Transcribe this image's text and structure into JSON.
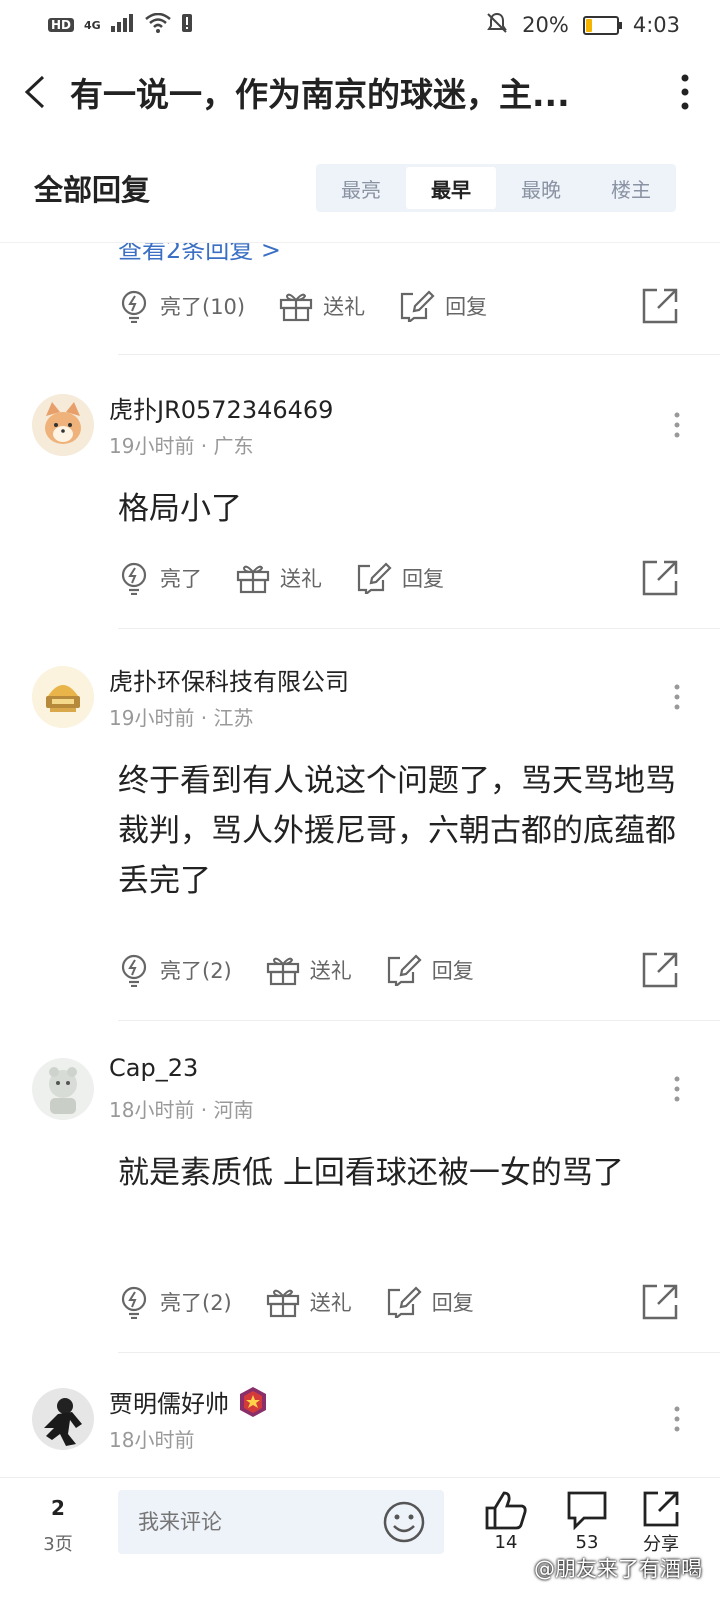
{
  "status": {
    "hd": "HD",
    "net": "4G",
    "battery_pct": "20%",
    "time": "4:03",
    "battery_level": 0.2
  },
  "header": {
    "title": "有一说一，作为南京的球迷，主..."
  },
  "sort": {
    "label": "全部回复",
    "options": [
      "最亮",
      "最早",
      "最晚",
      "楼主"
    ],
    "active_index": 1
  },
  "partial": {
    "link_text": "查看2条回复 >",
    "like_label": "亮了(10)",
    "gift_label": "送礼",
    "reply_label": "回复"
  },
  "comments": [
    {
      "user": "虎扑JR0572346469",
      "meta": "19小时前 · 广东",
      "text": "格局小了",
      "like_label": "亮了",
      "gift_label": "送礼",
      "reply_label": "回复"
    },
    {
      "user": "虎扑环保科技有限公司",
      "meta": "19小时前 · 江苏",
      "text": "终于看到有人说这个问题了，骂天骂地骂裁判，骂人外援尼哥，六朝古都的底蕴都丢完了",
      "like_label": "亮了(2)",
      "gift_label": "送礼",
      "reply_label": "回复"
    },
    {
      "user": "Cap_23",
      "meta": "18小时前 · 河南",
      "text": "就是素质低 上回看球还被一女的骂了",
      "like_label": "亮了(2)",
      "gift_label": "送礼",
      "reply_label": "回复"
    },
    {
      "user": "贾明儒好帅",
      "meta": "18小时前",
      "text": "",
      "like_label": "",
      "gift_label": "",
      "reply_label": ""
    }
  ],
  "bottom": {
    "page_current": "2",
    "page_total": "3页",
    "input_placeholder": "我来评论",
    "like_count": "14",
    "comment_count": "53",
    "share_label": "分享"
  },
  "watermark": "@朋友来了有酒喝",
  "colors": {
    "link": "#3a6fc4",
    "segment_bg": "#eef2f9",
    "battery": "#f5b400"
  }
}
